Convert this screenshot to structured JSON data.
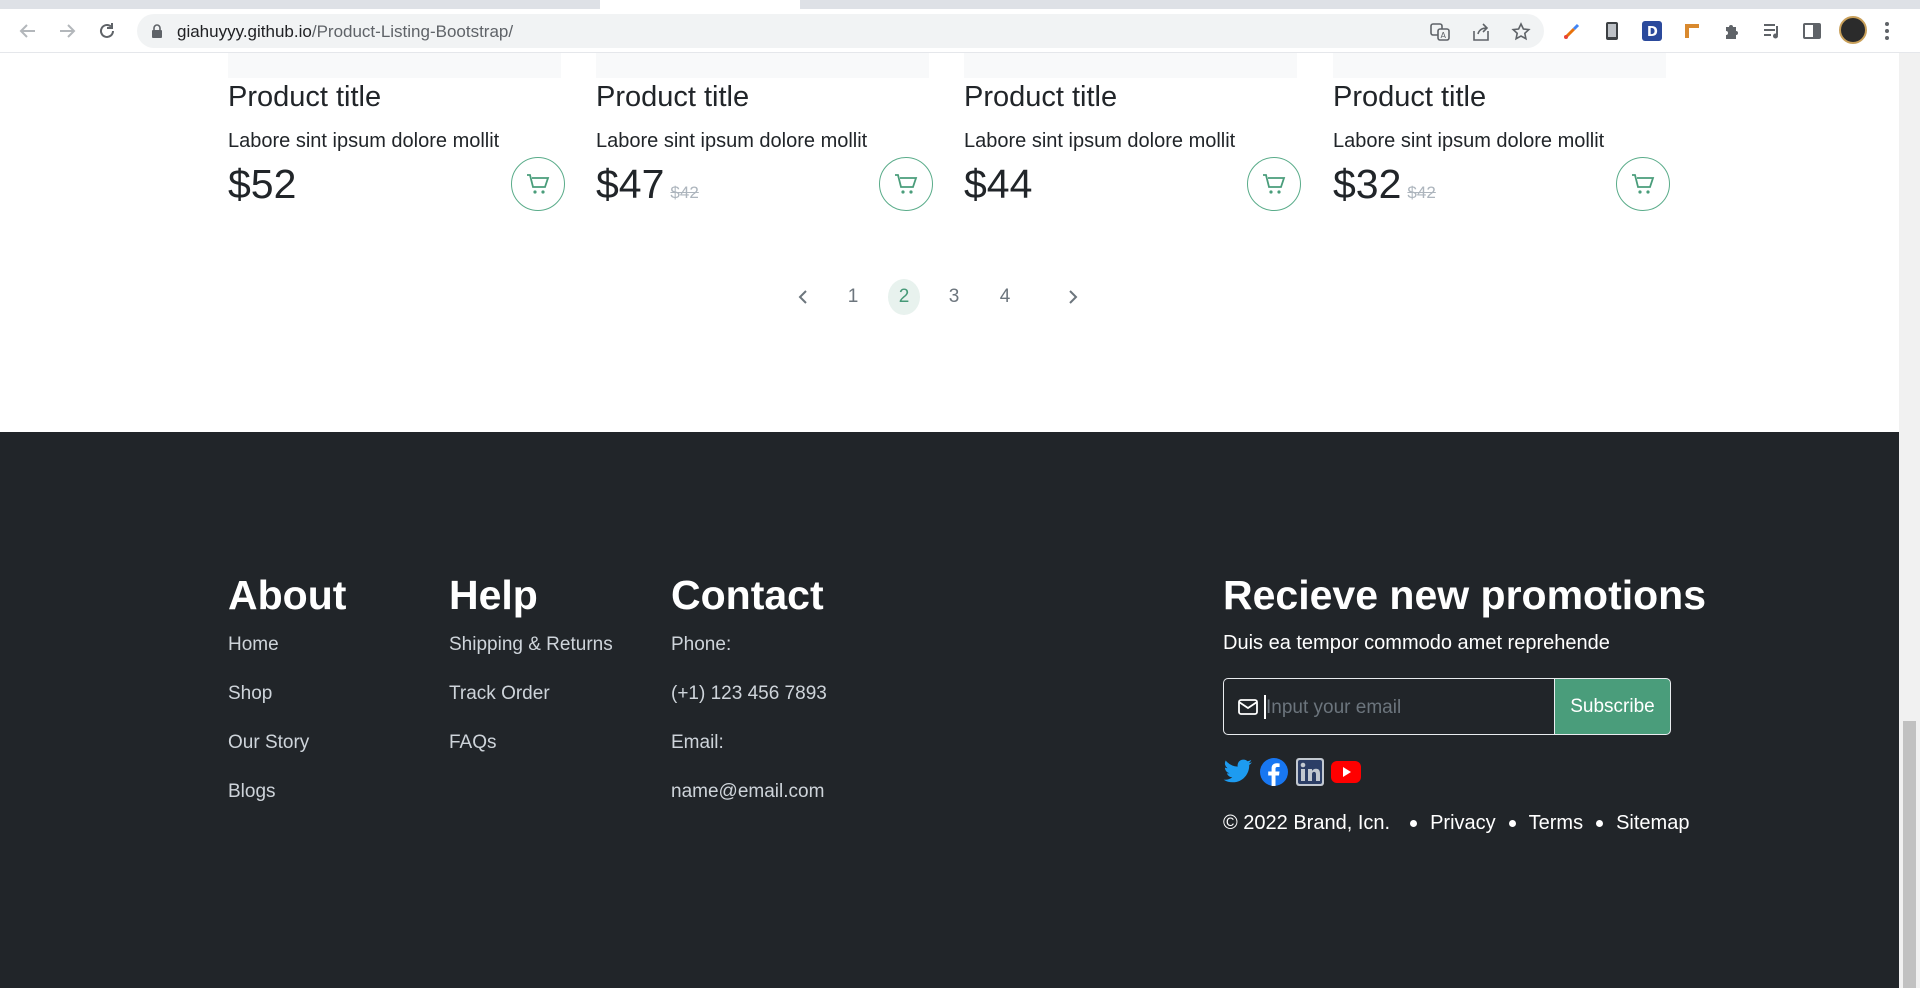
{
  "browser": {
    "url_host": "giahuyyy.github.io",
    "url_path": "/Product-Listing-Bootstrap/",
    "icons": [
      "back-arrow-icon",
      "forward-arrow-icon",
      "reload-icon",
      "lock-icon",
      "translate-icon",
      "share-icon",
      "bookmark-star-icon",
      "color-picker-extension-icon",
      "phone-extension-icon",
      "d-extension-icon",
      "ruler-extension-icon",
      "puzzle-extensions-icon",
      "media-queue-icon",
      "side-panel-icon",
      "profile-avatar",
      "kebab-menu-icon"
    ]
  },
  "products": [
    {
      "title": "Product title",
      "description": "Labore sint ipsum dolore mollit",
      "price": "$52",
      "old_price": ""
    },
    {
      "title": "Product title",
      "description": "Labore sint ipsum dolore mollit",
      "price": "$47",
      "old_price": "$42"
    },
    {
      "title": "Product title",
      "description": "Labore sint ipsum dolore mollit",
      "price": "$44",
      "old_price": ""
    },
    {
      "title": "Product title",
      "description": "Labore sint ipsum dolore mollit",
      "price": "$32",
      "old_price": "$42"
    }
  ],
  "pagination": {
    "pages": [
      "1",
      "2",
      "3",
      "4"
    ],
    "active_page": "2"
  },
  "footer": {
    "about": {
      "heading": "About",
      "links": [
        "Home",
        "Shop",
        "Our Story",
        "Blogs"
      ]
    },
    "help": {
      "heading": "Help",
      "links": [
        "Shipping & Returns",
        "Track Order",
        "FAQs"
      ]
    },
    "contact": {
      "heading": "Contact",
      "lines": [
        "Phone:",
        "(+1) 123 456 7893",
        "Email:",
        "name@email.com"
      ]
    },
    "promo": {
      "heading": "Recieve new promotions",
      "subtitle": "Duis ea tempor commodo amet reprehende",
      "email_placeholder": "Input your email",
      "email_value": "",
      "subscribe_label": "Subscribe"
    },
    "social": [
      "twitter-icon",
      "facebook-icon",
      "linkedin-icon",
      "youtube-icon"
    ],
    "legal": {
      "copyright": "© 2022 Brand, Icn.",
      "privacy": "Privacy",
      "terms": "Terms",
      "sitemap": "Sitemap"
    }
  },
  "colors": {
    "accent": "#4a9d7b",
    "footer_bg": "#212529",
    "pagination_active_bg": "#e8f2ee"
  }
}
